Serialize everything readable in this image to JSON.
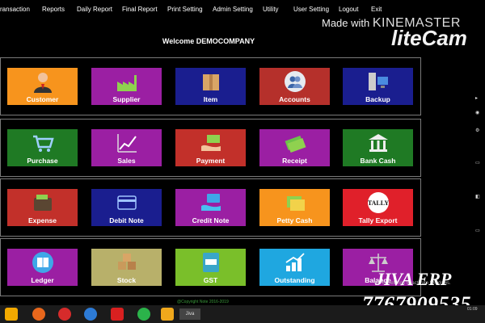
{
  "menu": [
    "ransaction",
    "Reports",
    "Daily Report",
    "Final Report",
    "Print Setting",
    "Admin Setting",
    "Utility",
    "User Setting",
    "Logout",
    "Exit"
  ],
  "watermark": {
    "made_with": "Made with",
    "kine": "KINEMASTER",
    "lite": "liteCam"
  },
  "welcome": "Welcome DEMOCOMPANY",
  "rows": [
    [
      {
        "label": "Customer",
        "color": "#f7941d",
        "icon": "person-icon"
      },
      {
        "label": "Supplier",
        "color": "#9b1fa3",
        "icon": "factory-icon"
      },
      {
        "label": "Item",
        "color": "#1a1e8f",
        "icon": "box-icon"
      },
      {
        "label": "Accounts",
        "color": "#b5302b",
        "icon": "users-icon"
      },
      {
        "label": "Backup",
        "color": "#1a1e8f",
        "icon": "server-icon"
      }
    ],
    [
      {
        "label": "Purchase",
        "color": "#1f7a24",
        "icon": "cart-icon"
      },
      {
        "label": "Sales",
        "color": "#9b1fa3",
        "icon": "chart-icon"
      },
      {
        "label": "Payment",
        "color": "#c2302a",
        "icon": "hand-money-icon"
      },
      {
        "label": "Receipt",
        "color": "#9b1fa3",
        "icon": "cash-icon"
      },
      {
        "label": "Bank Cash",
        "color": "#1f7a24",
        "icon": "bank-icon"
      }
    ],
    [
      {
        "label": "Expense",
        "color": "#c2302a",
        "icon": "wallet-icon"
      },
      {
        "label": "Debit Note",
        "color": "#1a1e8f",
        "icon": "card-icon"
      },
      {
        "label": "Credit Note",
        "color": "#9b1fa3",
        "icon": "hand-card-icon"
      },
      {
        "label": "Petty Cash",
        "color": "#f7941d",
        "icon": "bills-icon"
      },
      {
        "label": "Tally Export",
        "color": "#e0202a",
        "icon": "tally-icon"
      }
    ],
    [
      {
        "label": "Ledger",
        "color": "#9b1fa3",
        "icon": "ledger-icon"
      },
      {
        "label": "Stock",
        "color": "#b8b06a",
        "icon": "boxes-icon"
      },
      {
        "label": "GST",
        "color": "#7abf2a",
        "icon": "calculator-icon"
      },
      {
        "label": "Outstanding",
        "color": "#1fa7e0",
        "icon": "coins-icon"
      },
      {
        "label": "Balance",
        "color": "#9b1fa3",
        "icon": "scales-icon"
      }
    ]
  ],
  "tally_text": "Tally",
  "gst_text": "GST",
  "copyright": "@Copyright Note 2016-2019",
  "brand": "JIVA ERP",
  "phone": "7767909535",
  "win_activate": "Go to Settings to activate Windows.",
  "taskbar": {
    "app_label": "Jiva",
    "clock": "01:09"
  }
}
